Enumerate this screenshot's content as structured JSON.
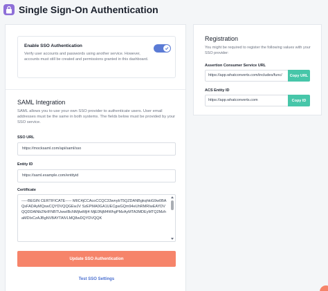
{
  "header": {
    "title": "Single Sign-On Authentication",
    "icon": "lock-icon"
  },
  "sso_toggle": {
    "title": "Enable SSO Authentication",
    "description": "Verify user accounts and passwords using another service. However, accounts must still be created and permissions granted in this dashboard.",
    "enabled": true
  },
  "saml": {
    "title": "SAML Integration",
    "description": "SAML allows you to use your own SSO provider to authenticate users. User email addresses must be the same in both systems. The fields below must be provided by your SSO service.",
    "sso_url": {
      "label": "SSO URL",
      "value": "https://mocksaml.com/api/saml/sso"
    },
    "entity_id": {
      "label": "Entity ID",
      "value": "https://saml.example.com/entityid"
    },
    "certificate": {
      "label": "Certificate",
      "value": "-----BEGIN CERTIFICATE----- MIIC4jCCAcoCCQC33wnybT5QZDANBgkqhkiG9w0BAQsFADAyMQswCQYDVQQGEwJV SzEPMA0GA1UECgwGQm94eUhRMRIwEAYDVQQDDAlNb2NrIFNBTUwwIBcNMjIwMjI4 MjE0NjM4WhgPMzAyMTA3MDEyMTQ2MzhaMDIxCzAJBgNVBAYTAlVLMQ8wDQYDVQQK"
    },
    "submit_label": "Update SSO Authentication",
    "test_label": "Test SSO Settings"
  },
  "registration": {
    "title": "Registration",
    "description": "You might be required to register the following values with your SSO provider:",
    "acs_url": {
      "label": "Assertion Consumer Service URL",
      "value": "https://app.whatconverts.com/includes/func/",
      "button": "Copy URL"
    },
    "acs_entity_id": {
      "label": "ACS Entity ID",
      "value": "https://app.whatconverts.com",
      "button": "Copy ID"
    }
  },
  "colors": {
    "primary": "#f6846a",
    "toggle": "#5b7bd5",
    "copy": "#47c6a9",
    "link": "#4a6fd0",
    "badge": "#8e6fd8"
  }
}
